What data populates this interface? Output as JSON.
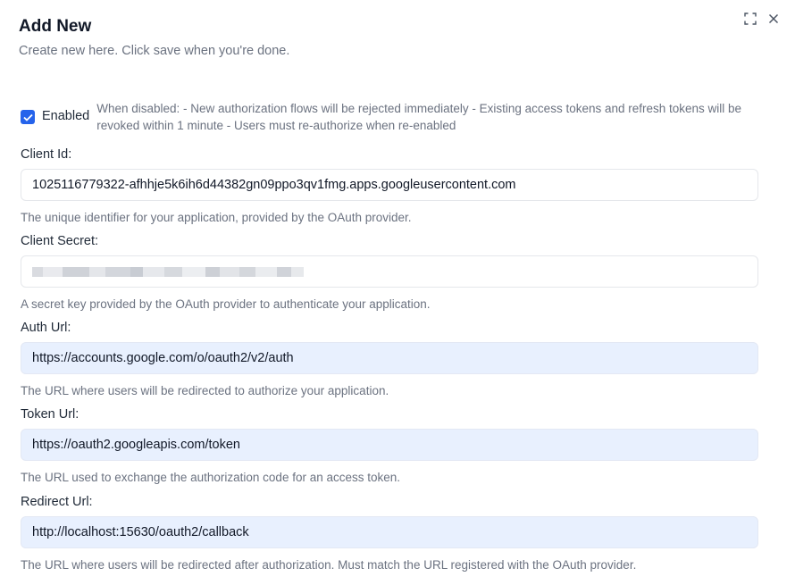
{
  "dialog": {
    "title": "Add New",
    "subtitle": "Create new here. Click save when you're done.",
    "icons": {
      "expand": "expand-icon",
      "close": "close-icon"
    }
  },
  "enabled": {
    "label": "Enabled",
    "checked": true,
    "description": "When disabled: - New authorization flows will be rejected immediately - Existing access tokens and refresh tokens will be revoked within 1 minute - Users must re-authorize when re-enabled"
  },
  "fields": {
    "client_id": {
      "label": "Client Id:",
      "value": "1025116779322-afhhje5k6ih6d44382gn09ppo3qv1fmg.apps.googleusercontent.com",
      "help": "The unique identifier for your application, provided by the OAuth provider."
    },
    "client_secret": {
      "label": "Client Secret:",
      "value": "",
      "help": "A secret key provided by the OAuth provider to authenticate your application."
    },
    "auth_url": {
      "label": "Auth Url:",
      "value": "https://accounts.google.com/o/oauth2/v2/auth",
      "help": "The URL where users will be redirected to authorize your application."
    },
    "token_url": {
      "label": "Token Url:",
      "value": "https://oauth2.googleapis.com/token",
      "help": "The URL used to exchange the authorization code for an access token."
    },
    "redirect_url": {
      "label": "Redirect Url:",
      "value": "http://localhost:15630/oauth2/callback",
      "help": "The URL where users will be redirected after authorization. Must match the URL registered with the OAuth provider."
    }
  },
  "colors": {
    "accent": "#2563eb",
    "filled_input_bg": "#e8f0fe",
    "muted_text": "#6b7280"
  }
}
